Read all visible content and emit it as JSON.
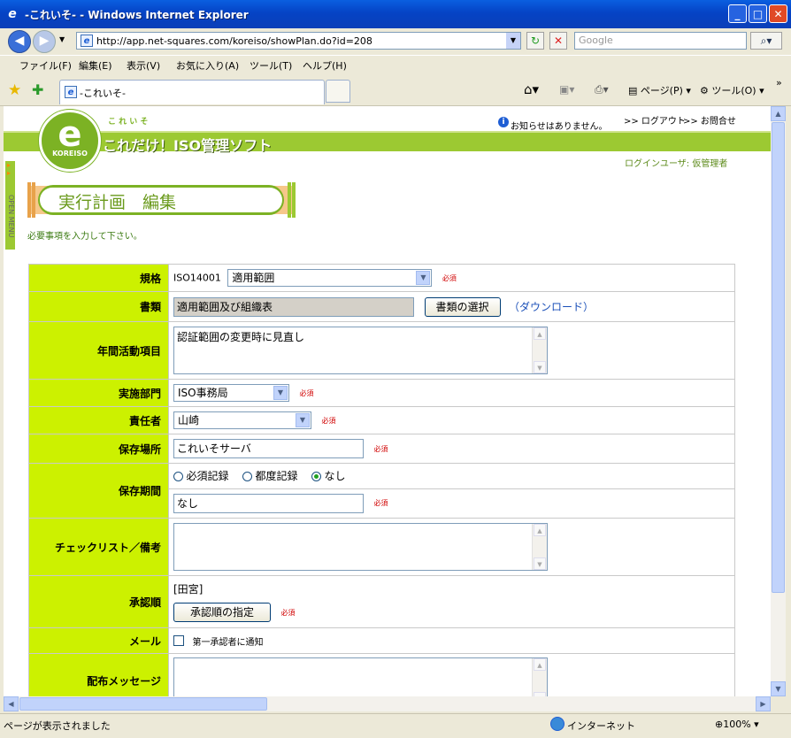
{
  "window": {
    "title": "-これいそ- - Windows Internet Explorer"
  },
  "address": {
    "url": "http://app.net-squares.com/koreiso/showPlan.do?id=208",
    "search_placeholder": "Google"
  },
  "menu": [
    "ファイル(F)",
    "編集(E)",
    "表示(V)",
    "お気に入り(A)",
    "ツール(T)",
    "ヘルプ(H)"
  ],
  "tab": {
    "label": "-これいそ-"
  },
  "toolbar_right": {
    "page": "ページ(P)",
    "tools": "ツール(O)"
  },
  "header": {
    "brand": "これだけ！ISO管理ソフト",
    "brand_kana": "こ れ い そ",
    "logo_letter": "e",
    "logo_ring": "KOREISO",
    "notice": "お知らせはありません。",
    "logout": ">> ログアウト",
    "contact": ">> お問合せ",
    "login_user": "ログインユーザ:  仮管理者",
    "side_menu": "OPEN MENU"
  },
  "page": {
    "title": "実行計画　編集",
    "instruction": "必要事項を入力して下さい。"
  },
  "form": {
    "required": "必須",
    "standard": {
      "label": "規格",
      "prefix": "ISO14001",
      "value": "適用範囲"
    },
    "document": {
      "label": "書類",
      "value": "適用範囲及び組織表",
      "select_button": "書類の選択",
      "download": "（ダウンロード）"
    },
    "annual_item": {
      "label": "年間活動項目",
      "value": "認証範囲の変更時に見直し"
    },
    "department": {
      "label": "実施部門",
      "value": "ISO事務局"
    },
    "owner": {
      "label": "責任者",
      "value": "山崎"
    },
    "location": {
      "label": "保存場所",
      "value": "これいそサーバ"
    },
    "period": {
      "label": "保存期間",
      "options": [
        "必須記録",
        "都度記録",
        "なし"
      ],
      "selected": "なし",
      "value": "なし"
    },
    "checklist": {
      "label": "チェックリスト／備考",
      "value": ""
    },
    "approval": {
      "label": "承認順",
      "value": "[田宮]",
      "button": "承認順の指定"
    },
    "mail": {
      "label": "メール",
      "option": "第一承認者に通知"
    },
    "message": {
      "label": "配布メッセージ",
      "value": ""
    }
  },
  "status": {
    "text": "ページが表示されました",
    "zone": "インターネット",
    "zoom": "100%"
  }
}
